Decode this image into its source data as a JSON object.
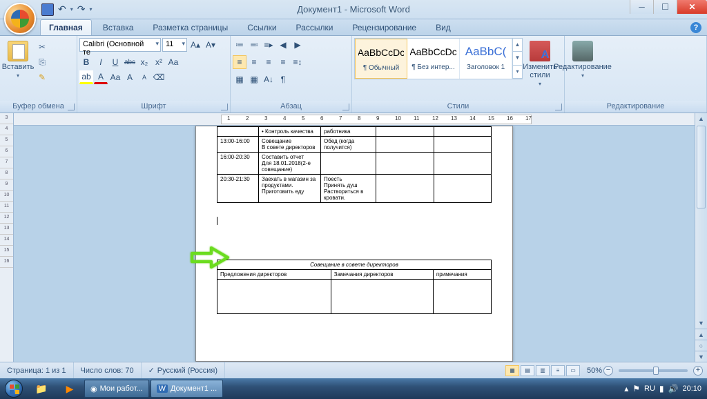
{
  "title": "Документ1 - Microsoft Word",
  "qat": {
    "undo": "↶",
    "redo": "↷"
  },
  "tabs": [
    "Главная",
    "Вставка",
    "Разметка страницы",
    "Ссылки",
    "Рассылки",
    "Рецензирование",
    "Вид"
  ],
  "ribbon": {
    "clipboard": {
      "label": "Буфер обмена",
      "paste": "Вставить"
    },
    "font": {
      "label": "Шрифт",
      "name": "Calibri (Основной те",
      "size": "11",
      "bold": "B",
      "italic": "I",
      "underline": "U",
      "strike": "abc",
      "sub": "x₂",
      "sup": "x²",
      "case": "Aa",
      "clear": "⌫",
      "grow": "A▴",
      "shrink": "A▾",
      "highlight": "ab",
      "color": "A"
    },
    "paragraph": {
      "label": "Абзац",
      "bullets": "≔",
      "numbers": "≕",
      "multilevel": "≡▸",
      "dec": "◀",
      "inc": "▶",
      "sort": "A↓",
      "marks": "¶",
      "left": "≡",
      "center": "≡",
      "right": "≡",
      "just": "≡",
      "spacing": "≡↕",
      "shading": "▦",
      "borders": "▦"
    },
    "styles": {
      "label": "Стили",
      "items": [
        {
          "preview": "AaBbCcDc",
          "name": "¶ Обычный",
          "color": "#000",
          "sel": true
        },
        {
          "preview": "AaBbCcDc",
          "name": "¶ Без интер...",
          "color": "#000"
        },
        {
          "preview": "AaBbC(",
          "name": "Заголовок 1",
          "color": "#3a6fd6",
          "size": "17px"
        }
      ],
      "change": "Изменить стили"
    },
    "editing": {
      "label": "Редактирование"
    }
  },
  "hruler_range": [
    1,
    17
  ],
  "vruler_range": [
    3,
    16
  ],
  "doc": {
    "table1": {
      "rows": [
        [
          "",
          "•  Контроль качества",
          "работника",
          "",
          ""
        ],
        [
          "13:00-16:00",
          "Совещание\nВ совете директоров",
          "Обед (когда получится)",
          "",
          ""
        ],
        [
          "16:00-20:30",
          "Составить отчет\nДля 18.01.2018(2-е совещание)",
          "",
          "",
          ""
        ],
        [
          "20:30-21:30",
          "Заехать в магазин за продуктами.\nПриготовить еду",
          "Поесть\nПринять душ\nРаствориться в кровати.",
          "",
          ""
        ]
      ]
    },
    "table2": {
      "title": "Совещание в совете директоров",
      "headers": [
        "Предложения директоров",
        "Замечания директоров",
        "примечания"
      ]
    }
  },
  "status": {
    "page": "Страница: 1 из 1",
    "words": "Число слов: 70",
    "lang": "Русский (Россия)",
    "zoom": "50%"
  },
  "taskbar": {
    "apps": [
      {
        "icon": "◉",
        "label": "Мои работ...",
        "color": "#fff"
      },
      {
        "icon": "W",
        "label": "Документ1 ...",
        "color": "#fff",
        "active": true
      }
    ],
    "lang": "RU",
    "time": "20:10"
  }
}
